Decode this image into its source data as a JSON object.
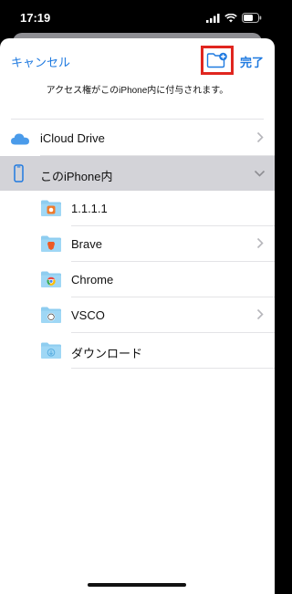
{
  "status": {
    "time": "17:19"
  },
  "nav": {
    "cancel": "キャンセル",
    "done": "完了"
  },
  "subtitle": "アクセス権がこのiPhone内に付与されます。",
  "locations": [
    {
      "label": "iCloud Drive"
    },
    {
      "label": "このiPhone内"
    }
  ],
  "folders": [
    {
      "label": "1.1.1.1"
    },
    {
      "label": "Brave"
    },
    {
      "label": "Chrome"
    },
    {
      "label": "VSCO"
    },
    {
      "label": "ダウンロード"
    }
  ],
  "colors": {
    "accent": "#1f7ae0",
    "highlight": "#e0261f",
    "selected_row": "#d3d3d8",
    "folder": "#8ecdf0"
  }
}
